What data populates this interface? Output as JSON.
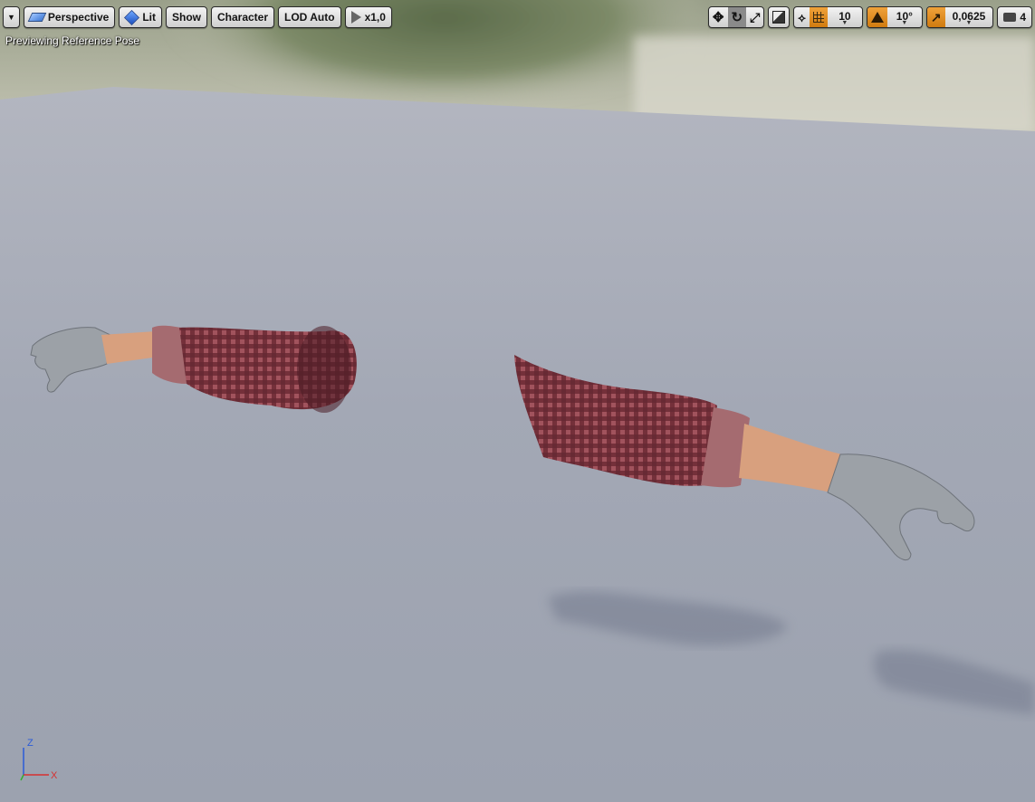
{
  "toolbar_left": {
    "options_menu_icon": "chevron-down-icon",
    "view_mode": {
      "label": "Perspective",
      "icon": "perspective-icon"
    },
    "lighting": {
      "label": "Lit",
      "icon": "lit-sphere-icon"
    },
    "show": {
      "label": "Show"
    },
    "character": {
      "label": "Character"
    },
    "lod": {
      "label": "LOD Auto"
    },
    "playback": {
      "label": "x1,0",
      "icon": "play-icon"
    }
  },
  "toolbar_right": {
    "transform_tools": [
      "move-icon",
      "rotate-icon",
      "scale-icon"
    ],
    "active_transform": "rotate-icon",
    "coordinate_icon": "world-cube-icon",
    "surface_snap_icon": "surface-snap-icon",
    "grid_snap": {
      "icon": "grid-icon",
      "value": "10"
    },
    "rotation_snap": {
      "icon": "angle-icon",
      "value": "10°"
    },
    "scale_snap": {
      "icon": "scale-arrow-icon",
      "value": "0,0625"
    },
    "camera_speed": {
      "icon": "camera-icon",
      "value": "4"
    }
  },
  "viewport": {
    "info": "Previewing Reference Pose",
    "axis": {
      "x": "X",
      "z": "Z"
    }
  },
  "colors": {
    "accent_orange": "#e08a1e",
    "floor": "#a6abb8",
    "sleeve": "#8a3b45",
    "glove": "#9aa0a6",
    "skin": "#d8a07e"
  }
}
